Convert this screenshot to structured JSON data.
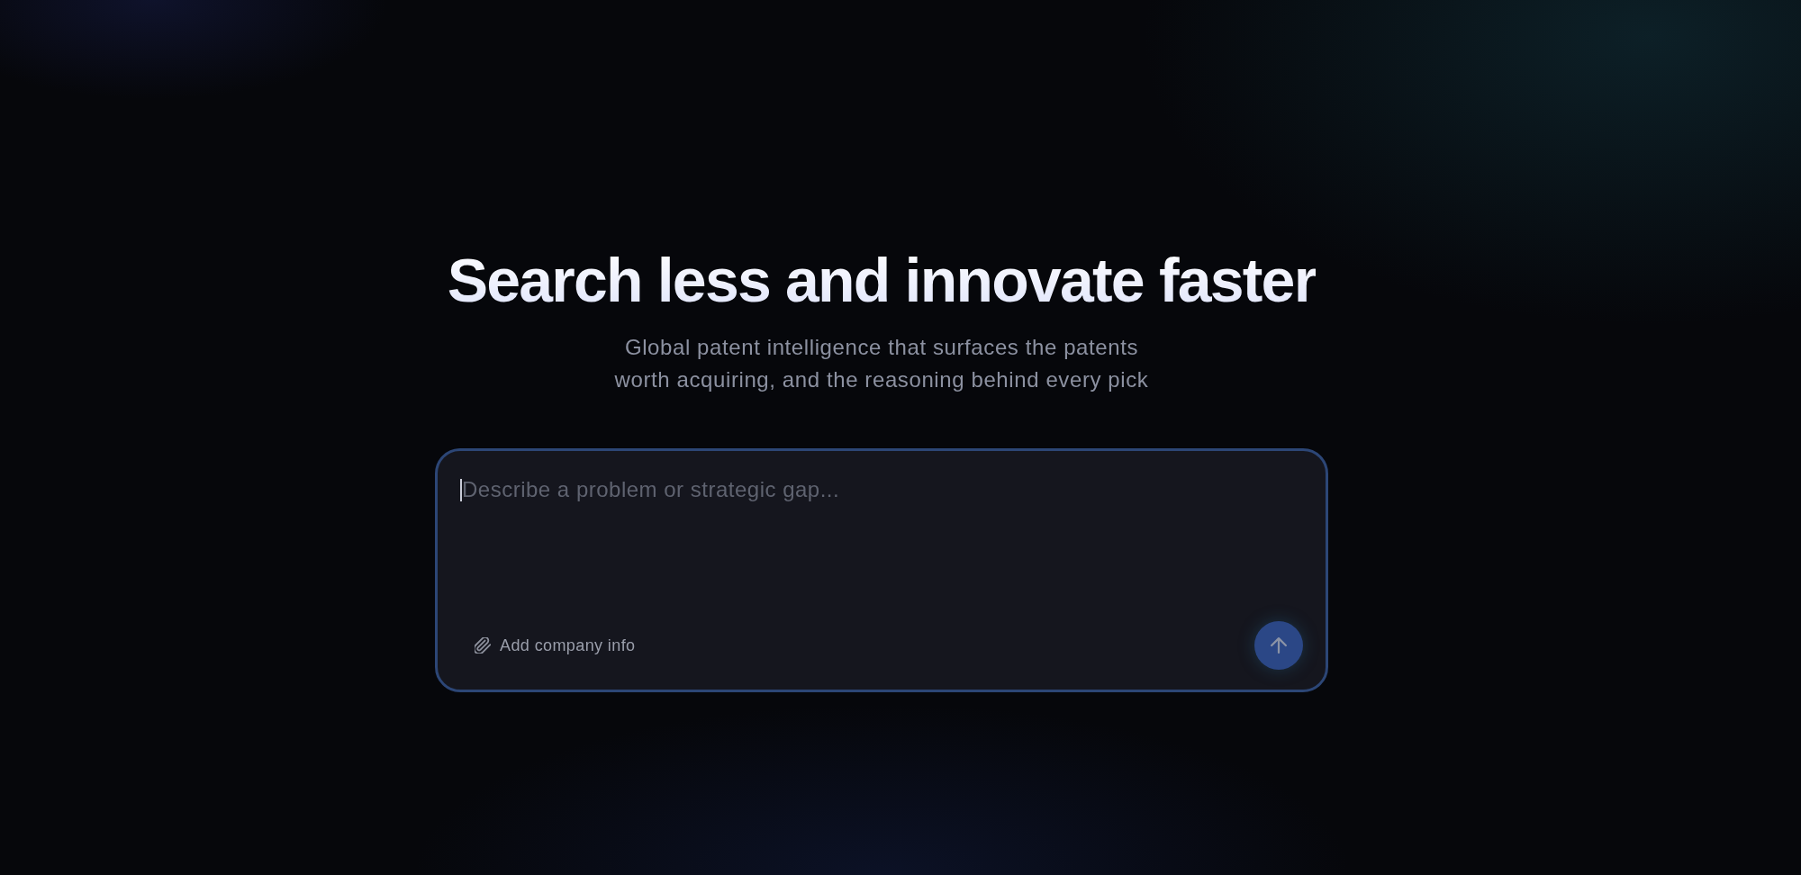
{
  "hero": {
    "title": "Search less and innovate faster",
    "subtitle": "Global patent intelligence that surfaces the patents\nworth acquiring, and the reasoning behind every pick"
  },
  "prompt": {
    "placeholder": "Describe a problem or strategic gap...",
    "focused": true,
    "attach_label": "Add company info"
  }
}
